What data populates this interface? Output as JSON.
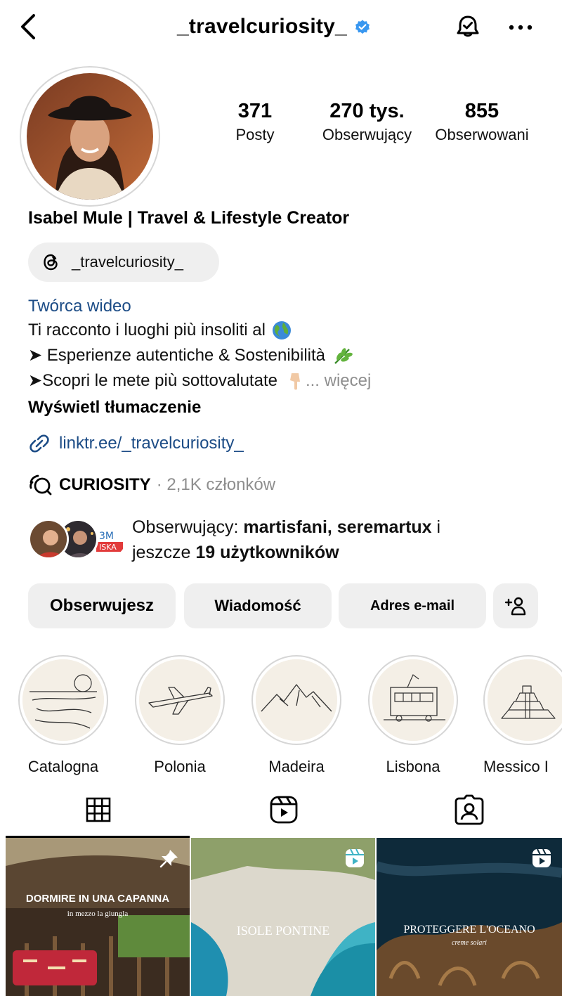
{
  "header": {
    "username": "_travelcuriosity_",
    "back_icon": "chevron-left-icon",
    "verified_icon": "verified-badge-icon",
    "bell_icon": "bell-icon",
    "more_icon": "ellipsis-icon"
  },
  "stats": {
    "posts_count": "371",
    "posts_label": "Posty",
    "followers_count": "270 tys.",
    "followers_label": "Obserwujący",
    "following_count": "855",
    "following_label": "Obserwowani"
  },
  "profile": {
    "full_name": "Isabel Mule | Travel & Lifestyle Creator",
    "threads_handle": "_travelcuriosity_",
    "category": "Twórca wideo",
    "bio_line_1": "Ti racconto i luoghi più insoliti al",
    "bio_line_2": "➤ Esperienze autentiche & Sostenibilità",
    "bio_line_3": "➤Scopri le mete più sottovalutate",
    "more_label": "... więcej",
    "translate_label": "Wyświetl tłumaczenie",
    "link_text": "linktr.ee/_travelcuriosity_",
    "channel_name": "CURIOSITY",
    "channel_meta": "· 2,1K członków"
  },
  "mutual": {
    "prefix": "Obserwujący:",
    "names": "martisfani, seremartux",
    "joiner": "i",
    "suffix_start": "jeszcze",
    "count_label": "19 użytkowników"
  },
  "actions": {
    "follow_label": "Obserwujesz",
    "message_label": "Wiadomość",
    "email_label": "Adres e-mail",
    "add_person_icon": "add-person-icon"
  },
  "highlights": [
    {
      "label": "Catalogna"
    },
    {
      "label": "Polonia"
    },
    {
      "label": "Madeira"
    },
    {
      "label": "Lisbona"
    },
    {
      "label": "Messico I"
    }
  ],
  "tabs": {
    "grid_icon": "grid-icon",
    "reels_icon": "reels-icon",
    "tagged_icon": "tagged-icon",
    "active": "grid"
  },
  "posts": [
    {
      "title": "DORMIRE IN UNA CAPANNA",
      "subtitle": "in mezzo la giungla",
      "badge": "pin-icon"
    },
    {
      "title": "ISOLE PONTINE",
      "badge": "reel-icon"
    },
    {
      "title": "PROTEGGERE L'OCEANO",
      "subtitle": "creme solari",
      "badge": "reel-icon"
    }
  ],
  "colors": {
    "link_blue": "#1c4c86",
    "verified_blue": "#3897f0",
    "button_grey": "#efefef",
    "muted_text": "#8e8e8e"
  }
}
